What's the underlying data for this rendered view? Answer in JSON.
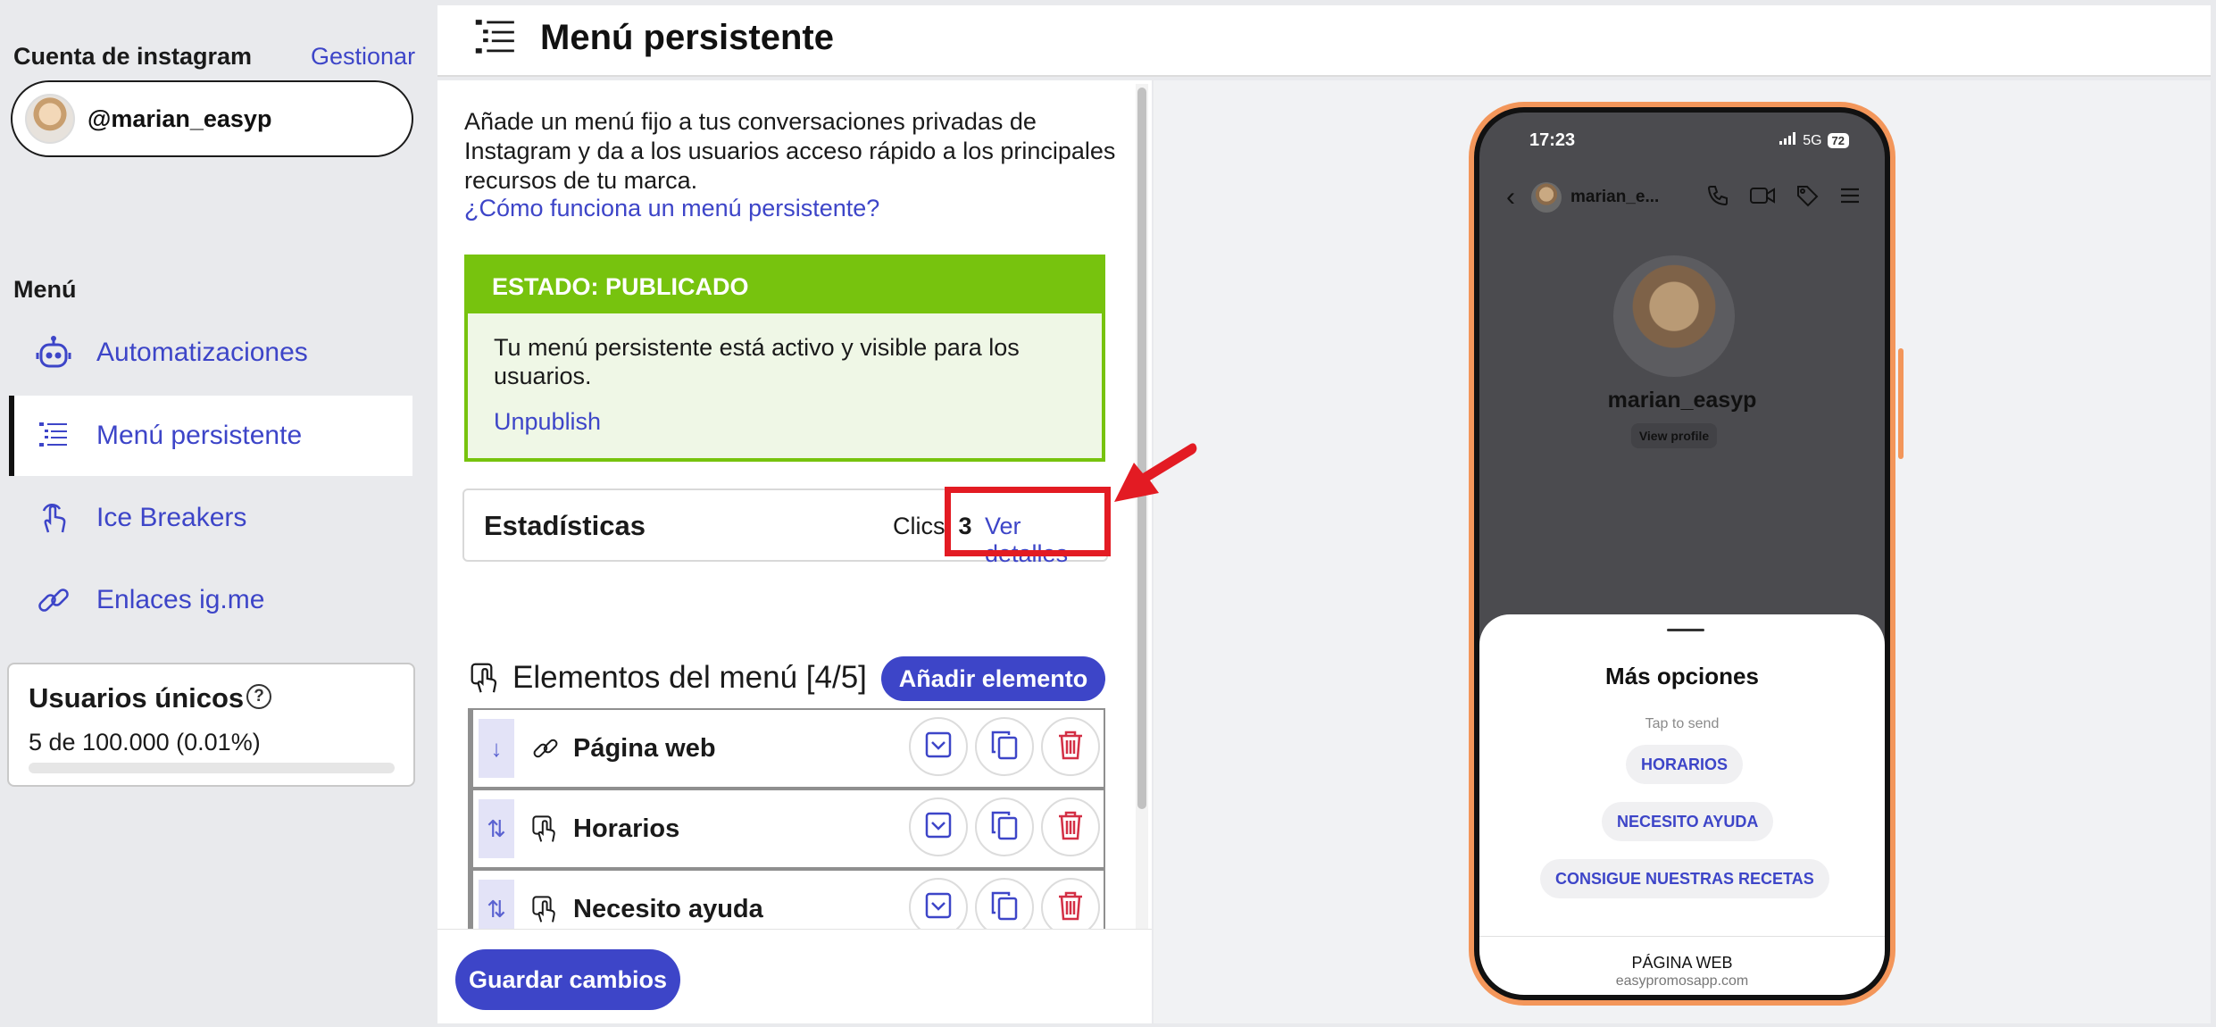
{
  "sidebar": {
    "account_title": "Cuenta de instagram",
    "manage_label": "Gestionar",
    "account_handle": "@marian_easyp",
    "menu_title": "Menú",
    "items": [
      {
        "label": "Automatizaciones",
        "icon": "robot-icon"
      },
      {
        "label": "Menú persistente",
        "icon": "list-icon",
        "active": true
      },
      {
        "label": "Ice Breakers",
        "icon": "tap-hand-icon"
      },
      {
        "label": "Enlaces ig.me",
        "icon": "link-icon"
      }
    ],
    "users": {
      "title": "Usuarios únicos",
      "help": "?",
      "count": "5 de 100.000 (0.01%)",
      "progress_fraction": 0.0001
    }
  },
  "header": {
    "title": "Menú persistente",
    "icon": "list-icon"
  },
  "editor": {
    "description": "Añade un menú fijo a tus conversaciones privadas de Instagram y da a los usuarios acceso rápido a los principales recursos de tu marca.",
    "help_link": "¿Cómo funciona un menú persistente?",
    "status": {
      "header": "ESTADO: PUBLICADO",
      "text": "Tu menú persistente está activo y visible para los usuarios.",
      "unpublish": "Unpublish"
    },
    "stats": {
      "title": "Estadísticas",
      "clicks_label": "Clics:",
      "clicks_value": "3",
      "details_link": "Ver detalles"
    },
    "elements": {
      "title": "Elementos del menú [4/5]",
      "add_button": "Añadir elemento",
      "rows": [
        {
          "label": "Página web",
          "drag": "↓",
          "icon": "link-icon"
        },
        {
          "label": "Horarios",
          "drag": "⇅",
          "icon": "tap-hand-icon"
        },
        {
          "label": "Necesito ayuda",
          "drag": "⇅",
          "icon": "tap-hand-icon"
        }
      ]
    },
    "save_button": "Guardar cambios"
  },
  "preview": {
    "time": "17:23",
    "network": "5G",
    "battery": "72",
    "chat_name": "marian_e...",
    "username": "marian_easyp",
    "view_profile": "View profile",
    "sheet": {
      "title": "Más opciones",
      "subtitle": "Tap to send",
      "chips": [
        "HORARIOS",
        "NECESITO AYUDA",
        "CONSIGUE NUESTRAS RECETAS"
      ],
      "web_title": "PÁGINA WEB",
      "web_url": "easypromosapp.com"
    }
  },
  "colors": {
    "accent": "#3d45c8",
    "success": "#77c30e",
    "danger": "#d32f45",
    "highlight": "#e31b23",
    "phone_frame": "#f3965a"
  }
}
